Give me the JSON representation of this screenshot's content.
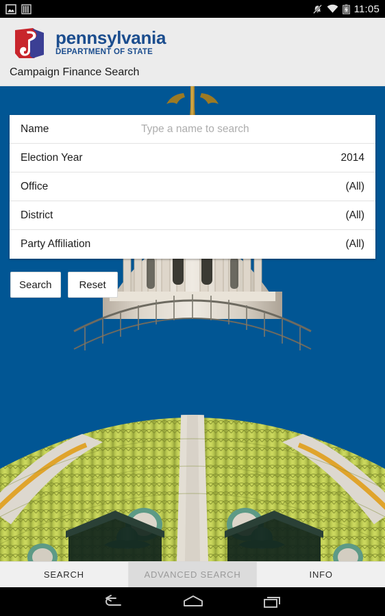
{
  "statusbar": {
    "clock": "11:05",
    "left_icons": [
      "screenshot-icon",
      "sdcard-icon"
    ],
    "right_icons": [
      "ringer-muted-icon",
      "wifi-icon",
      "battery-charging-icon"
    ]
  },
  "header": {
    "logo_icon": "pennsylvania-keystone-logo",
    "wordmark": "pennsylvania",
    "wordmark_sub": "DEPARTMENT OF STATE",
    "app_subtitle": "Campaign Finance Search",
    "brand_blue": "#1b4d8e",
    "brand_red": "#c8252c",
    "background": "#ececec"
  },
  "backdrop": {
    "accent_blue": "#015694",
    "photo_name": "pennsylvania-state-capitol-dome"
  },
  "form": {
    "rows": [
      {
        "label": "Name",
        "value": "",
        "placeholder": "Type a name to search",
        "type": "text-input",
        "name": "name"
      },
      {
        "label": "Election Year",
        "value": "2014",
        "placeholder": "",
        "type": "select",
        "name": "election-year"
      },
      {
        "label": "Office",
        "value": "(All)",
        "placeholder": "",
        "type": "select",
        "name": "office"
      },
      {
        "label": "District",
        "value": "(All)",
        "placeholder": "",
        "type": "select",
        "name": "district"
      },
      {
        "label": "Party Affiliation",
        "value": "(All)",
        "placeholder": "",
        "type": "select",
        "name": "party-affiliation"
      }
    ]
  },
  "actions": {
    "search_label": "Search",
    "reset_label": "Reset"
  },
  "tabbar": {
    "tabs": [
      {
        "label": "SEARCH",
        "name": "tab-search",
        "pressed": false
      },
      {
        "label": "ADVANCED SEARCH",
        "name": "tab-advanced-search",
        "pressed": true
      },
      {
        "label": "INFO",
        "name": "tab-info",
        "pressed": false
      }
    ]
  },
  "navbar": {
    "back_icon": "back-arrow-icon",
    "home_icon": "home-icon",
    "recents_icon": "recent-apps-icon"
  }
}
